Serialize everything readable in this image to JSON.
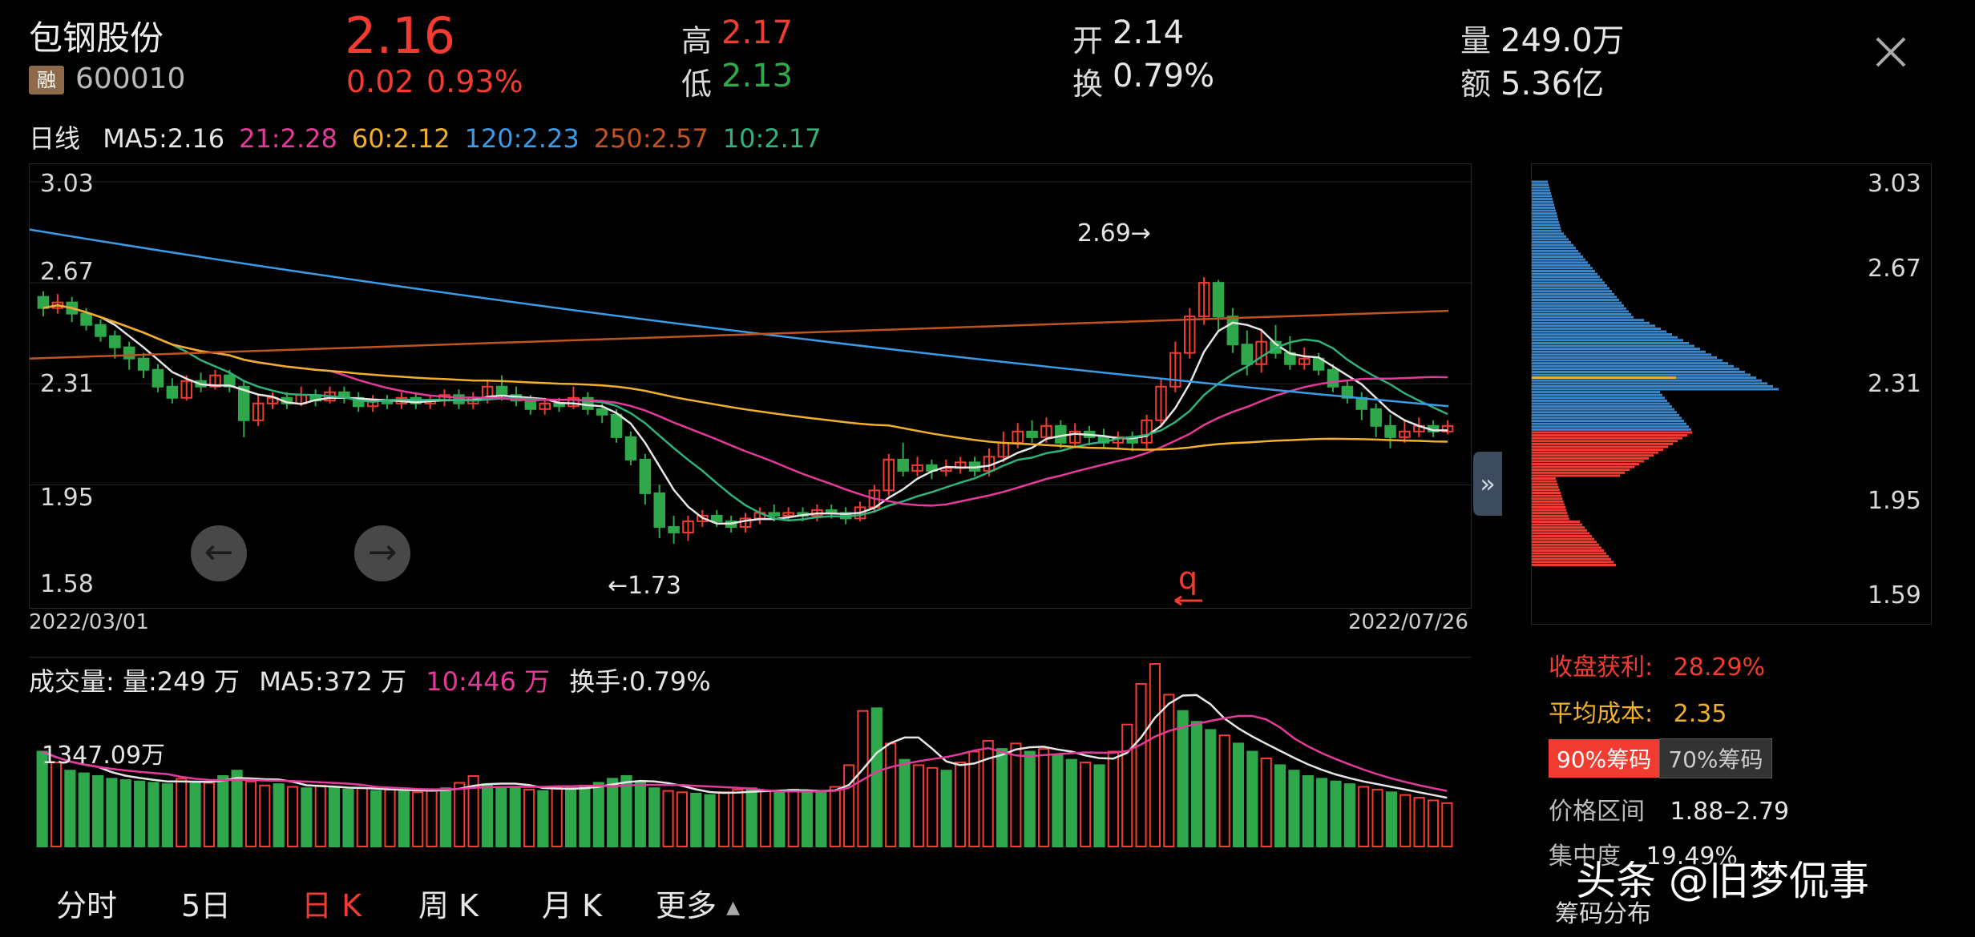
{
  "stock": {
    "name": "包钢股份",
    "rong_badge": "融",
    "code": "600010",
    "price": "2.16",
    "change": "0.02",
    "change_pct": "0.93%",
    "high_label": "高",
    "high": "2.17",
    "low_label": "低",
    "low": "2.13",
    "open_label": "开",
    "open": "2.14",
    "turnover_label": "换",
    "turnover": "0.79%",
    "volume_label": "量",
    "volume": "249.0万",
    "amount_label": "额",
    "amount": "5.36亿"
  },
  "ma_bar": {
    "period": "日线",
    "items": [
      {
        "text": "MA5:2.16",
        "color": "#e6e6e6"
      },
      {
        "text": "21:2.28",
        "color": "#e5399b"
      },
      {
        "text": "60:2.12",
        "color": "#f0b02c"
      },
      {
        "text": "120:2.23",
        "color": "#3a9ce8"
      },
      {
        "text": "250:2.57",
        "color": "#c0541f"
      },
      {
        "text": "10:2.17",
        "color": "#2fb37a"
      }
    ]
  },
  "price_axis": {
    "top": "3.03",
    "l2": "2.67",
    "l3": "2.31",
    "l4": "1.95",
    "bottom": "1.58"
  },
  "chart_annotations": {
    "high_mark": "2.69→",
    "low_mark": "←1.73",
    "start_date": "2022/03/01",
    "end_date": "2022/07/26",
    "signal": "q"
  },
  "volume_bar": {
    "title": "成交量:",
    "vol": "量:249 万",
    "ma5": "MA5:372 万",
    "ma10": "10:446 万",
    "turnover": "换手:0.79%",
    "max_label": "1347.09万"
  },
  "chip_panel": {
    "axis": {
      "top": "3.03",
      "l2": "2.67",
      "l3": "2.31",
      "l4": "1.95",
      "bottom": "1.59"
    },
    "profit_label": "收盘获利:",
    "profit": "28.29%",
    "avg_cost_label": "平均成本:",
    "avg_cost": "2.35",
    "tab_90": "90%筹码",
    "tab_70": "70%筹码",
    "range_label": "价格区间",
    "range": "1.88–2.79",
    "concentration_label": "集中度",
    "concentration": "19.49%",
    "footer": "筹码分布"
  },
  "tabs": [
    "分时",
    "5日",
    "日 K",
    "周 K",
    "月 K",
    "更多"
  ],
  "watermark": "头条 @旧梦侃事",
  "colors": {
    "up": "#f23b31",
    "down": "#2ea84a",
    "avg_cost_line": "#f0b02c",
    "chip_profit": "#f23b31",
    "chip_loss": "#3a86c8"
  },
  "chart_data": {
    "type": "candlestick",
    "x_start": "2022/03/01",
    "x_end": "2022/07/26",
    "ylim": [
      1.58,
      3.03
    ],
    "candles": [
      [
        2.62,
        2.58,
        2.64,
        2.55
      ],
      [
        2.58,
        2.6,
        2.63,
        2.56
      ],
      [
        2.6,
        2.56,
        2.62,
        2.53
      ],
      [
        2.56,
        2.52,
        2.58,
        2.5
      ],
      [
        2.52,
        2.48,
        2.54,
        2.46
      ],
      [
        2.48,
        2.44,
        2.5,
        2.4
      ],
      [
        2.44,
        2.4,
        2.46,
        2.36
      ],
      [
        2.4,
        2.36,
        2.42,
        2.33
      ],
      [
        2.36,
        2.3,
        2.38,
        2.28
      ],
      [
        2.3,
        2.26,
        2.33,
        2.24
      ],
      [
        2.26,
        2.32,
        2.34,
        2.25
      ],
      [
        2.32,
        2.3,
        2.35,
        2.28
      ],
      [
        2.3,
        2.34,
        2.36,
        2.29
      ],
      [
        2.34,
        2.3,
        2.36,
        2.28
      ],
      [
        2.3,
        2.18,
        2.32,
        2.12
      ],
      [
        2.18,
        2.24,
        2.27,
        2.16
      ],
      [
        2.24,
        2.26,
        2.28,
        2.22
      ],
      [
        2.26,
        2.24,
        2.28,
        2.22
      ],
      [
        2.24,
        2.27,
        2.3,
        2.23
      ],
      [
        2.27,
        2.25,
        2.29,
        2.23
      ],
      [
        2.25,
        2.28,
        2.3,
        2.24
      ],
      [
        2.28,
        2.26,
        2.3,
        2.24
      ],
      [
        2.26,
        2.23,
        2.28,
        2.21
      ],
      [
        2.23,
        2.25,
        2.27,
        2.21
      ],
      [
        2.25,
        2.24,
        2.27,
        2.22
      ],
      [
        2.24,
        2.26,
        2.28,
        2.22
      ],
      [
        2.26,
        2.24,
        2.28,
        2.22
      ],
      [
        2.24,
        2.25,
        2.27,
        2.22
      ],
      [
        2.25,
        2.27,
        2.29,
        2.23
      ],
      [
        2.27,
        2.24,
        2.29,
        2.22
      ],
      [
        2.24,
        2.26,
        2.28,
        2.22
      ],
      [
        2.26,
        2.3,
        2.32,
        2.24
      ],
      [
        2.3,
        2.27,
        2.34,
        2.25
      ],
      [
        2.27,
        2.25,
        2.3,
        2.23
      ],
      [
        2.25,
        2.22,
        2.27,
        2.2
      ],
      [
        2.22,
        2.24,
        2.26,
        2.2
      ],
      [
        2.24,
        2.23,
        2.26,
        2.21
      ],
      [
        2.23,
        2.26,
        2.3,
        2.22
      ],
      [
        2.26,
        2.22,
        2.28,
        2.2
      ],
      [
        2.22,
        2.2,
        2.24,
        2.17
      ],
      [
        2.2,
        2.12,
        2.22,
        2.1
      ],
      [
        2.12,
        2.04,
        2.14,
        2.02
      ],
      [
        2.04,
        1.92,
        2.06,
        1.88
      ],
      [
        1.92,
        1.8,
        1.95,
        1.76
      ],
      [
        1.8,
        1.78,
        1.84,
        1.74
      ],
      [
        1.78,
        1.82,
        1.84,
        1.75
      ],
      [
        1.82,
        1.84,
        1.86,
        1.8
      ],
      [
        1.84,
        1.82,
        1.86,
        1.8
      ],
      [
        1.82,
        1.8,
        1.84,
        1.78
      ],
      [
        1.8,
        1.83,
        1.85,
        1.78
      ],
      [
        1.83,
        1.85,
        1.87,
        1.81
      ],
      [
        1.85,
        1.84,
        1.88,
        1.82
      ],
      [
        1.84,
        1.85,
        1.87,
        1.82
      ],
      [
        1.85,
        1.84,
        1.87,
        1.82
      ],
      [
        1.84,
        1.86,
        1.88,
        1.82
      ],
      [
        1.86,
        1.85,
        1.88,
        1.83
      ],
      [
        1.85,
        1.83,
        1.87,
        1.81
      ],
      [
        1.83,
        1.87,
        1.89,
        1.82
      ],
      [
        1.87,
        1.93,
        1.95,
        1.85
      ],
      [
        1.93,
        2.04,
        2.06,
        1.91
      ],
      [
        2.04,
        2.0,
        2.1,
        1.98
      ],
      [
        2.0,
        2.02,
        2.05,
        1.98
      ],
      [
        2.02,
        2.0,
        2.04,
        1.97
      ],
      [
        2.0,
        2.01,
        2.04,
        1.98
      ],
      [
        2.01,
        2.03,
        2.05,
        1.99
      ],
      [
        2.03,
        2.0,
        2.05,
        1.98
      ],
      [
        2.0,
        2.05,
        2.08,
        1.98
      ],
      [
        2.05,
        2.1,
        2.14,
        2.03
      ],
      [
        2.1,
        2.14,
        2.17,
        2.08
      ],
      [
        2.14,
        2.12,
        2.18,
        2.1
      ],
      [
        2.12,
        2.16,
        2.19,
        2.1
      ],
      [
        2.16,
        2.1,
        2.18,
        2.08
      ],
      [
        2.1,
        2.14,
        2.17,
        2.08
      ],
      [
        2.14,
        2.12,
        2.16,
        2.09
      ],
      [
        2.12,
        2.1,
        2.15,
        2.08
      ],
      [
        2.1,
        2.12,
        2.14,
        2.08
      ],
      [
        2.12,
        2.1,
        2.14,
        2.07
      ],
      [
        2.1,
        2.18,
        2.2,
        2.08
      ],
      [
        2.18,
        2.3,
        2.33,
        2.16
      ],
      [
        2.3,
        2.42,
        2.46,
        2.28
      ],
      [
        2.42,
        2.55,
        2.58,
        2.4
      ],
      [
        2.55,
        2.67,
        2.69,
        2.52
      ],
      [
        2.67,
        2.55,
        2.68,
        2.5
      ],
      [
        2.55,
        2.45,
        2.58,
        2.42
      ],
      [
        2.45,
        2.38,
        2.5,
        2.34
      ],
      [
        2.38,
        2.46,
        2.5,
        2.35
      ],
      [
        2.46,
        2.42,
        2.52,
        2.4
      ],
      [
        2.42,
        2.38,
        2.48,
        2.36
      ],
      [
        2.38,
        2.4,
        2.44,
        2.36
      ],
      [
        2.4,
        2.36,
        2.42,
        2.34
      ],
      [
        2.36,
        2.3,
        2.38,
        2.28
      ],
      [
        2.3,
        2.26,
        2.32,
        2.24
      ],
      [
        2.26,
        2.22,
        2.28,
        2.18
      ],
      [
        2.22,
        2.16,
        2.24,
        2.12
      ],
      [
        2.16,
        2.12,
        2.2,
        2.08
      ],
      [
        2.12,
        2.14,
        2.18,
        2.1
      ],
      [
        2.14,
        2.16,
        2.19,
        2.12
      ],
      [
        2.16,
        2.14,
        2.18,
        2.12
      ],
      [
        2.14,
        2.16,
        2.18,
        2.13
      ]
    ],
    "volumes": [
      700,
      620,
      560,
      540,
      520,
      500,
      490,
      480,
      470,
      460,
      500,
      480,
      470,
      520,
      560,
      480,
      450,
      460,
      440,
      430,
      450,
      430,
      420,
      430,
      410,
      420,
      410,
      400,
      420,
      430,
      470,
      520,
      460,
      440,
      430,
      420,
      410,
      440,
      430,
      450,
      470,
      500,
      520,
      480,
      430,
      410,
      400,
      390,
      380,
      400,
      420,
      430,
      410,
      400,
      420,
      410,
      400,
      440,
      600,
      1000,
      1020,
      760,
      640,
      600,
      580,
      560,
      620,
      700,
      780,
      720,
      760,
      700,
      720,
      680,
      640,
      620,
      600,
      700,
      900,
      1200,
      1347,
      1120,
      1000,
      920,
      860,
      820,
      760,
      700,
      650,
      600,
      560,
      520,
      500,
      480,
      460,
      440,
      420,
      400,
      380,
      360,
      340,
      320
    ],
    "chip_price_levels": [
      3.03,
      2.67,
      2.31,
      1.95,
      1.59
    ],
    "chip_avg_cost": 2.35,
    "chip_profit_pct": 28.29
  }
}
